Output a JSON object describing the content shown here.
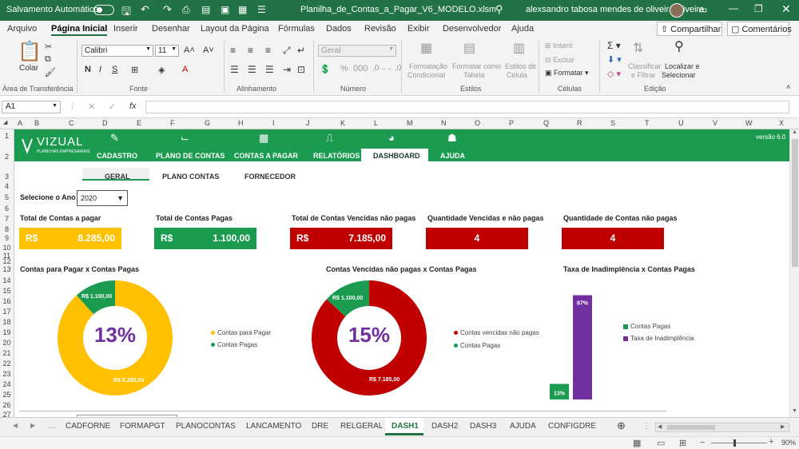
{
  "titlebar": {
    "autosave_label": "Salvamento Automático",
    "filename": "Planilha_de_Contas_a_Pagar_V6_MODELO.xlsm",
    "user": "alexsandro tabosa mendes de oliveira oliveira"
  },
  "menu": [
    "Arquivo",
    "Página Inicial",
    "Inserir",
    "Desenhar",
    "Layout da Página",
    "Fórmulas",
    "Dados",
    "Revisão",
    "Exibir",
    "Desenvolvedor",
    "Ajuda"
  ],
  "share_label": "Compartilhar",
  "comments_label": "Comentários",
  "ribbon": {
    "paste": "Colar",
    "font_name": "Calibri",
    "font_size": "11",
    "number_format": "Geral",
    "groups": {
      "clipboard": "Área de Transferência",
      "font": "Fonte",
      "alignment": "Alinhamento",
      "number": "Número",
      "styles": "Estilos",
      "cells": "Células",
      "editing": "Edição"
    },
    "styles_buttons": [
      "Formatação",
      "Condicional",
      "Formatar como",
      "Tabela",
      "Estilos de",
      "Célula"
    ],
    "cells_buttons": [
      "Inserir",
      "Excluir",
      "Formatar"
    ],
    "edit_buttons": [
      "Classificar",
      "e Filtrar",
      "Localizar e",
      "Selecionar"
    ]
  },
  "namebox": "A1",
  "fx": "fx",
  "columns": [
    "A",
    "B",
    "C",
    "D",
    "E",
    "F",
    "G",
    "H",
    "I",
    "J",
    "K",
    "L",
    "M",
    "N",
    "O",
    "P",
    "Q",
    "R",
    "S",
    "T",
    "U",
    "V",
    "W",
    "X"
  ],
  "rows": [
    "1",
    "2",
    "3",
    "4",
    "5",
    "6",
    "7",
    "8",
    "9",
    "10",
    "11",
    "12",
    "13",
    "14",
    "15",
    "16",
    "17",
    "18",
    "19",
    "20",
    "21",
    "22",
    "23",
    "24",
    "25",
    "26",
    "27"
  ],
  "dashboard": {
    "logo_text": "VIZUAL",
    "logo_sub": "PLANILHAS EMPRESARIAIS",
    "version": "versão 6.0",
    "nav": [
      "CADASTRO",
      "PLANO DE CONTAS",
      "CONTAS A PAGAR",
      "RELATÓRIOS",
      "DASHBOARD",
      "AJUDA"
    ],
    "subtabs": [
      "GERAL",
      "PLANO CONTAS",
      "FORNECEDOR"
    ],
    "year_label": "Selecione o Ano",
    "year_value": "2020",
    "kpis": [
      {
        "label": "Total de Contas a pagar",
        "currency": "R$",
        "value": "8.285,00",
        "color": "#ffc000"
      },
      {
        "label": "Total de Contas Pagas",
        "currency": "R$",
        "value": "1.100,00",
        "color": "#1a9b50"
      },
      {
        "label": "Total de Contas Vencidas não pagas",
        "currency": "R$",
        "value": "7.185,00",
        "color": "#c00000"
      },
      {
        "label": "Quantidade Vencidas e não pagas",
        "value": "4",
        "color": "#c00000"
      },
      {
        "label": "Quantidade de Contas não pagas",
        "value": "4",
        "color": "#c00000"
      }
    ]
  },
  "chart_data": [
    {
      "type": "pie",
      "title": "Contas para Pagar x Contas Pagas",
      "center_label": "13%",
      "categories": [
        "Contas para Pagar",
        "Contas Pagas"
      ],
      "values": [
        8285,
        1100
      ],
      "labels": [
        "R$ 8.285,00",
        "R$ 1.100,00"
      ],
      "colors": [
        "#ffc000",
        "#1a9b50"
      ]
    },
    {
      "type": "pie",
      "title": "Contas Vencidas não pagas x Contas Pagas",
      "center_label": "15%",
      "categories": [
        "Contas vencidas não pagas",
        "Contas Pagas"
      ],
      "values": [
        7185,
        1100
      ],
      "labels": [
        "R$ 7.185,00",
        "R$ 1.100,00"
      ],
      "colors": [
        "#c00000",
        "#1a9b50"
      ]
    },
    {
      "type": "bar",
      "title": "Taxa de Inadimplência x Contas Pagas",
      "categories": [
        "Contas Pagas",
        "Taxa de Inadimplência"
      ],
      "values": [
        13,
        87
      ],
      "labels": [
        "13%",
        "87%"
      ],
      "ylim": [
        0,
        100
      ],
      "colors": [
        "#1a9b50",
        "#7030a0"
      ]
    }
  ],
  "sheets": [
    "CADFORNE",
    "FORMAPGT",
    "PLANOCONTAS",
    "LANCAMENTO",
    "DRE",
    "RELGERAL",
    "DASH1",
    "DASH2",
    "DASH3",
    "AJUDA",
    "CONFIGDRE"
  ],
  "active_sheet": "DASH1",
  "zoom": "90%"
}
